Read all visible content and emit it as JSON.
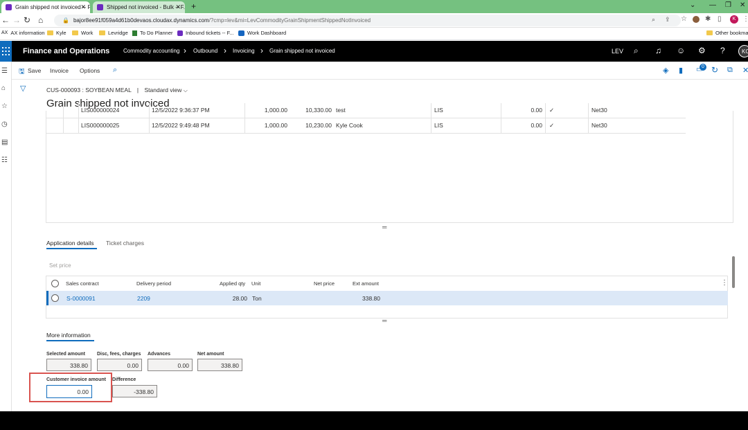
{
  "browser": {
    "tabs": [
      {
        "title": "Grain shipped not invoiced -- Fi...",
        "active": true
      },
      {
        "title": "Shipped not invoiced - Bulk -- F...",
        "active": false
      }
    ],
    "new_tab": "+",
    "url_host": "bajor8ee91f059a4d61b0devaos.cloudax.dynamics.com",
    "url_path": "/?cmp=lev&mi=LevCommodityGrainShipmentShippedNotInvoiced",
    "profile_initial": "K",
    "bookmarks": [
      "AX information",
      "Kyle",
      "Work",
      "Levridge",
      "To Do Planner",
      "Inbound tickets -- F...",
      "Work Dashboard"
    ],
    "other_bookmarks": "Other bookmarks"
  },
  "header": {
    "app_name": "Finance and Operations",
    "breadcrumbs": [
      "Commodity accounting",
      "Outbound",
      "Invoicing",
      "Grain shipped not invoiced"
    ],
    "company": "LEV",
    "user_initials": "KC",
    "notification_count": "0"
  },
  "actions": {
    "save": "Save",
    "invoice": "Invoice",
    "options": "Options"
  },
  "page": {
    "context": "CUS-000093 : SOYBEAN MEAL",
    "view_separator": "|",
    "view": "Standard view",
    "title": "Grain shipped not invoiced"
  },
  "shipments": [
    {
      "id": "LIS000000024",
      "datetime": "12/5/2022 9:36:37 PM",
      "qty": "1,000.00",
      "amount": "10,330.00",
      "name": "test",
      "site": "LIS",
      "value": "0.00",
      "check": "✓",
      "terms": "Net30"
    },
    {
      "id": "LIS000000025",
      "datetime": "12/5/2022 9:49:48 PM",
      "qty": "1,000.00",
      "amount": "10,230.00",
      "name": "Kyle Cook",
      "site": "LIS",
      "value": "0.00",
      "check": "✓",
      "terms": "Net30"
    }
  ],
  "tabs": {
    "application_details": "Application details",
    "ticket_charges": "Ticket charges"
  },
  "set_price": "Set price",
  "lines": {
    "headers": {
      "sales_contract": "Sales contract",
      "delivery_period": "Delivery period",
      "applied_qty": "Applied qty",
      "unit": "Unit",
      "net_price": "Net price",
      "ext_amount": "Ext amount"
    },
    "rows": [
      {
        "sales_contract": "S-0000091",
        "delivery_period": "2209",
        "applied_qty": "28.00",
        "unit": "Ton",
        "net_price": "",
        "ext_amount": "338.80"
      }
    ]
  },
  "more_info": {
    "tab": "More information",
    "selected_amount_label": "Selected amount",
    "selected_amount": "338.80",
    "disc_label": "Disc, fees, charges",
    "disc": "0.00",
    "advances_label": "Advances",
    "advances": "0.00",
    "net_amount_label": "Net amount",
    "net_amount": "338.80",
    "customer_invoice_label": "Customer invoice amount",
    "customer_invoice": "0.00",
    "difference_label": "Difference",
    "difference": "-338.80"
  }
}
